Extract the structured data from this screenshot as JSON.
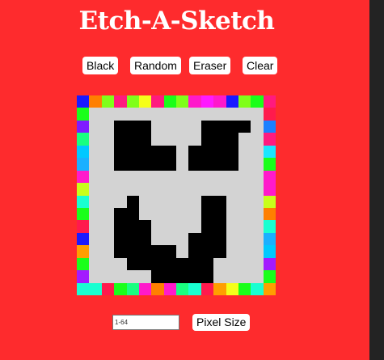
{
  "title": "Etch-A-Sketch",
  "controls": {
    "black_label": "Black",
    "random_label": "Random",
    "eraser_label": "Eraser",
    "clear_label": "Clear"
  },
  "size_form": {
    "placeholder": "1-64",
    "value": "",
    "button_label": "Pixel Size"
  },
  "colors": {
    "page_background": "#fe2b2d",
    "board_background": "#d3d3d3",
    "drawn": "#000000",
    "side_strip": "#232323"
  },
  "board": {
    "grid_size": 16,
    "palette": {
      ".": "#d3d3d3",
      "K": "#000000",
      "a": "#7f1aff",
      "b": "#ff7f00",
      "c": "#7fff1a",
      "d": "#ff1a7f",
      "e": "#19ffd1",
      "f": "#1ab0ff",
      "g": "#f5ff1a",
      "h": "#1a1aff",
      "i": "#19ff7f",
      "j": "#ff1acb",
      "k": "#00c8ff",
      "l": "#ff1a4d",
      "m": "#1aff1a",
      "n": "#c8ff1a",
      "o": "#ff9f00",
      "p": "#ff1aff",
      "q": "#19e6ff",
      "r": "#a31aff",
      "s": "#1a80ff"
    },
    "rows": [
      "hbcdcgdmcjpjhcmd",
      "m..............l",
      "a..KKK....KKKK.s",
      "i..KKK....KKK..d",
      "k..KKKKK.KKKK..q",
      "f..KKKKK.KKKK..m",
      "j..............j",
      "n..............j",
      "e...K.....KK...n",
      "m..KK.....KK...b",
      "l..KKK....KK...e",
      "h..KKK...KKK...f",
      "o..KKKKK.KKK...k",
      "m...KKKKKKK....r",
      "r.....KKKKK....m",
      "eelmijbjielogmeo"
    ]
  }
}
